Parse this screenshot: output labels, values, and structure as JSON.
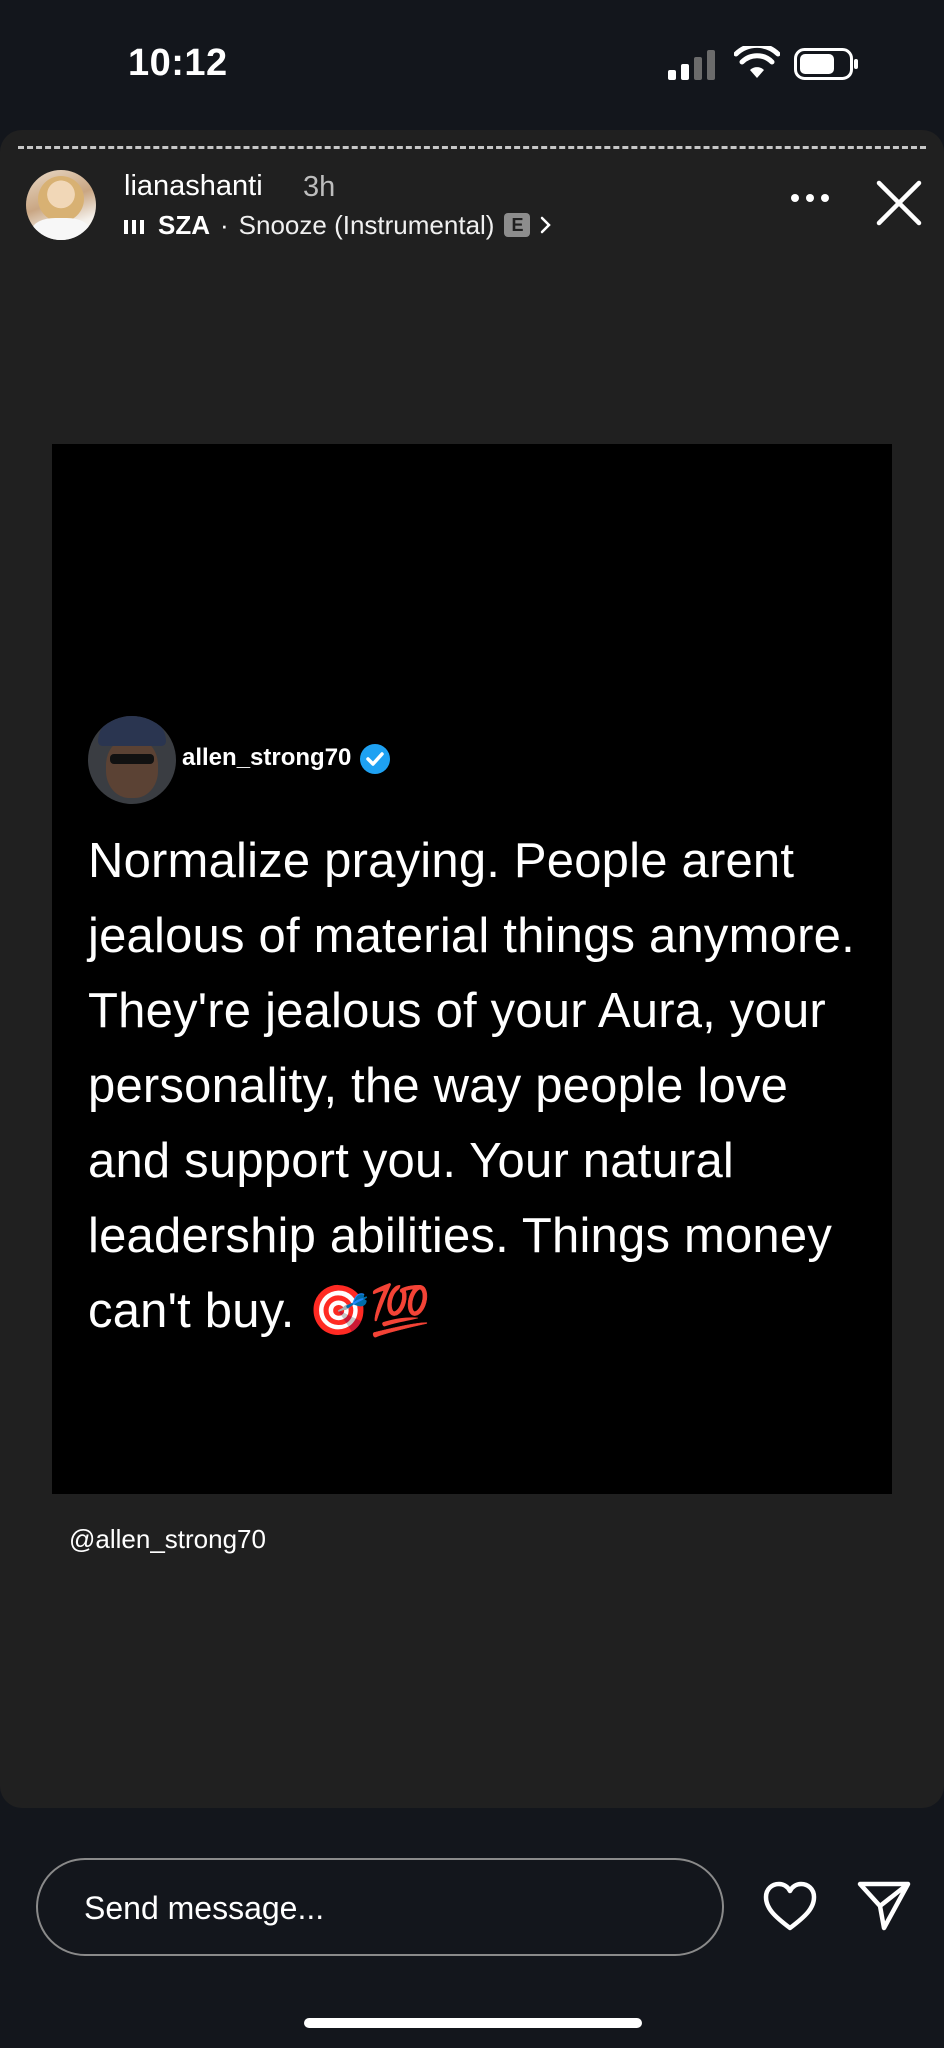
{
  "status_bar": {
    "time": "10:12"
  },
  "story": {
    "username": "lianashanti",
    "timestamp": "3h",
    "music": {
      "artist": "SZA",
      "separator": "·",
      "song": "Snooze (Instrumental)",
      "explicit_badge": "E"
    },
    "progress_segments": 1
  },
  "post": {
    "author": "allen_strong70",
    "verified": true,
    "text": "Normalize praying. People arent jealous of material things anymore. They're jealous of your Aura, your personality, the way people love and support you. Your natural leadership abilities. Things money can't buy. 🎯💯",
    "handle_caption": "@allen_strong70"
  },
  "bottom_bar": {
    "message_placeholder": "Send message..."
  },
  "icons": {
    "signal": "cellular-signal-icon",
    "wifi": "wifi-icon",
    "battery": "battery-icon",
    "music": "music-bars-icon",
    "chevron": "chevron-right-icon",
    "more": "more-options-icon",
    "close": "close-icon",
    "verified": "verified-badge-icon",
    "heart": "heart-icon",
    "send": "send-icon"
  },
  "colors": {
    "background": "#13161c",
    "story_card": "#202020",
    "post_background": "#000000",
    "verified_blue": "#1ea1f2",
    "text": "#ffffff"
  }
}
